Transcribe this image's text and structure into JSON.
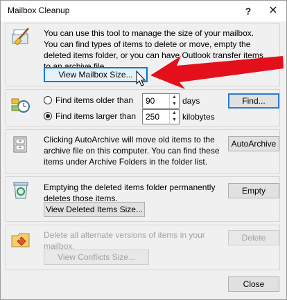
{
  "window": {
    "title": "Mailbox Cleanup",
    "help": "?",
    "close": "✕"
  },
  "section_size": {
    "line1": "You can use this tool to manage the size of your mailbox.",
    "line2": "You can find types of items to delete or move, empty the deleted items folder, or you can have Outlook transfer items to an archive file.",
    "button": "View Mailbox Size..."
  },
  "section_find": {
    "older_label": "Find items older than",
    "older_value": "90",
    "older_unit": "days",
    "larger_label": "Find items larger than",
    "larger_value": "250",
    "larger_unit": "kilobytes",
    "find_button": "Find...",
    "selected": "larger"
  },
  "section_archive": {
    "text": "Clicking AutoArchive will move old items to the archive file on this computer. You can find these items under Archive Folders in the folder list.",
    "button": "AutoArchive"
  },
  "section_deleted": {
    "text": "Emptying the deleted items folder permanently deletes those items.",
    "view_button": "View Deleted Items Size...",
    "empty_button": "Empty"
  },
  "section_conflicts": {
    "text": "Delete all alternate versions of items in your mailbox.",
    "view_button": "View Conflicts Size...",
    "delete_button": "Delete"
  },
  "footer": {
    "close_button": "Close"
  },
  "colors": {
    "arrow": "#e3101c",
    "focus": "#2a7ad6"
  }
}
